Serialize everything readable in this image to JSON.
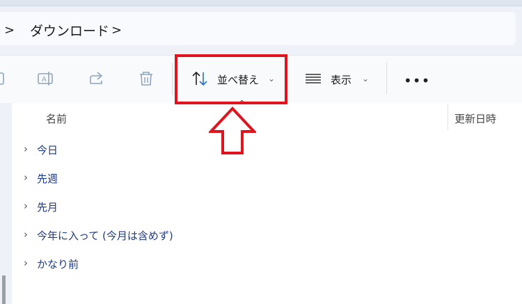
{
  "breadcrumb": {
    "folder": "ダウンロード"
  },
  "toolbar": {
    "sort_label": "並べ替え",
    "view_label": "表示",
    "more_label": "•••"
  },
  "columns": {
    "name": "名前",
    "modified": "更新日時"
  },
  "groups": [
    {
      "label": "今日"
    },
    {
      "label": "先週"
    },
    {
      "label": "先月"
    },
    {
      "label": "今年に入って (今月は含めず)"
    },
    {
      "label": "かなり前"
    }
  ],
  "annotation": {
    "highlight_color": "#e1131c",
    "arrow_color": "#e1131c"
  }
}
